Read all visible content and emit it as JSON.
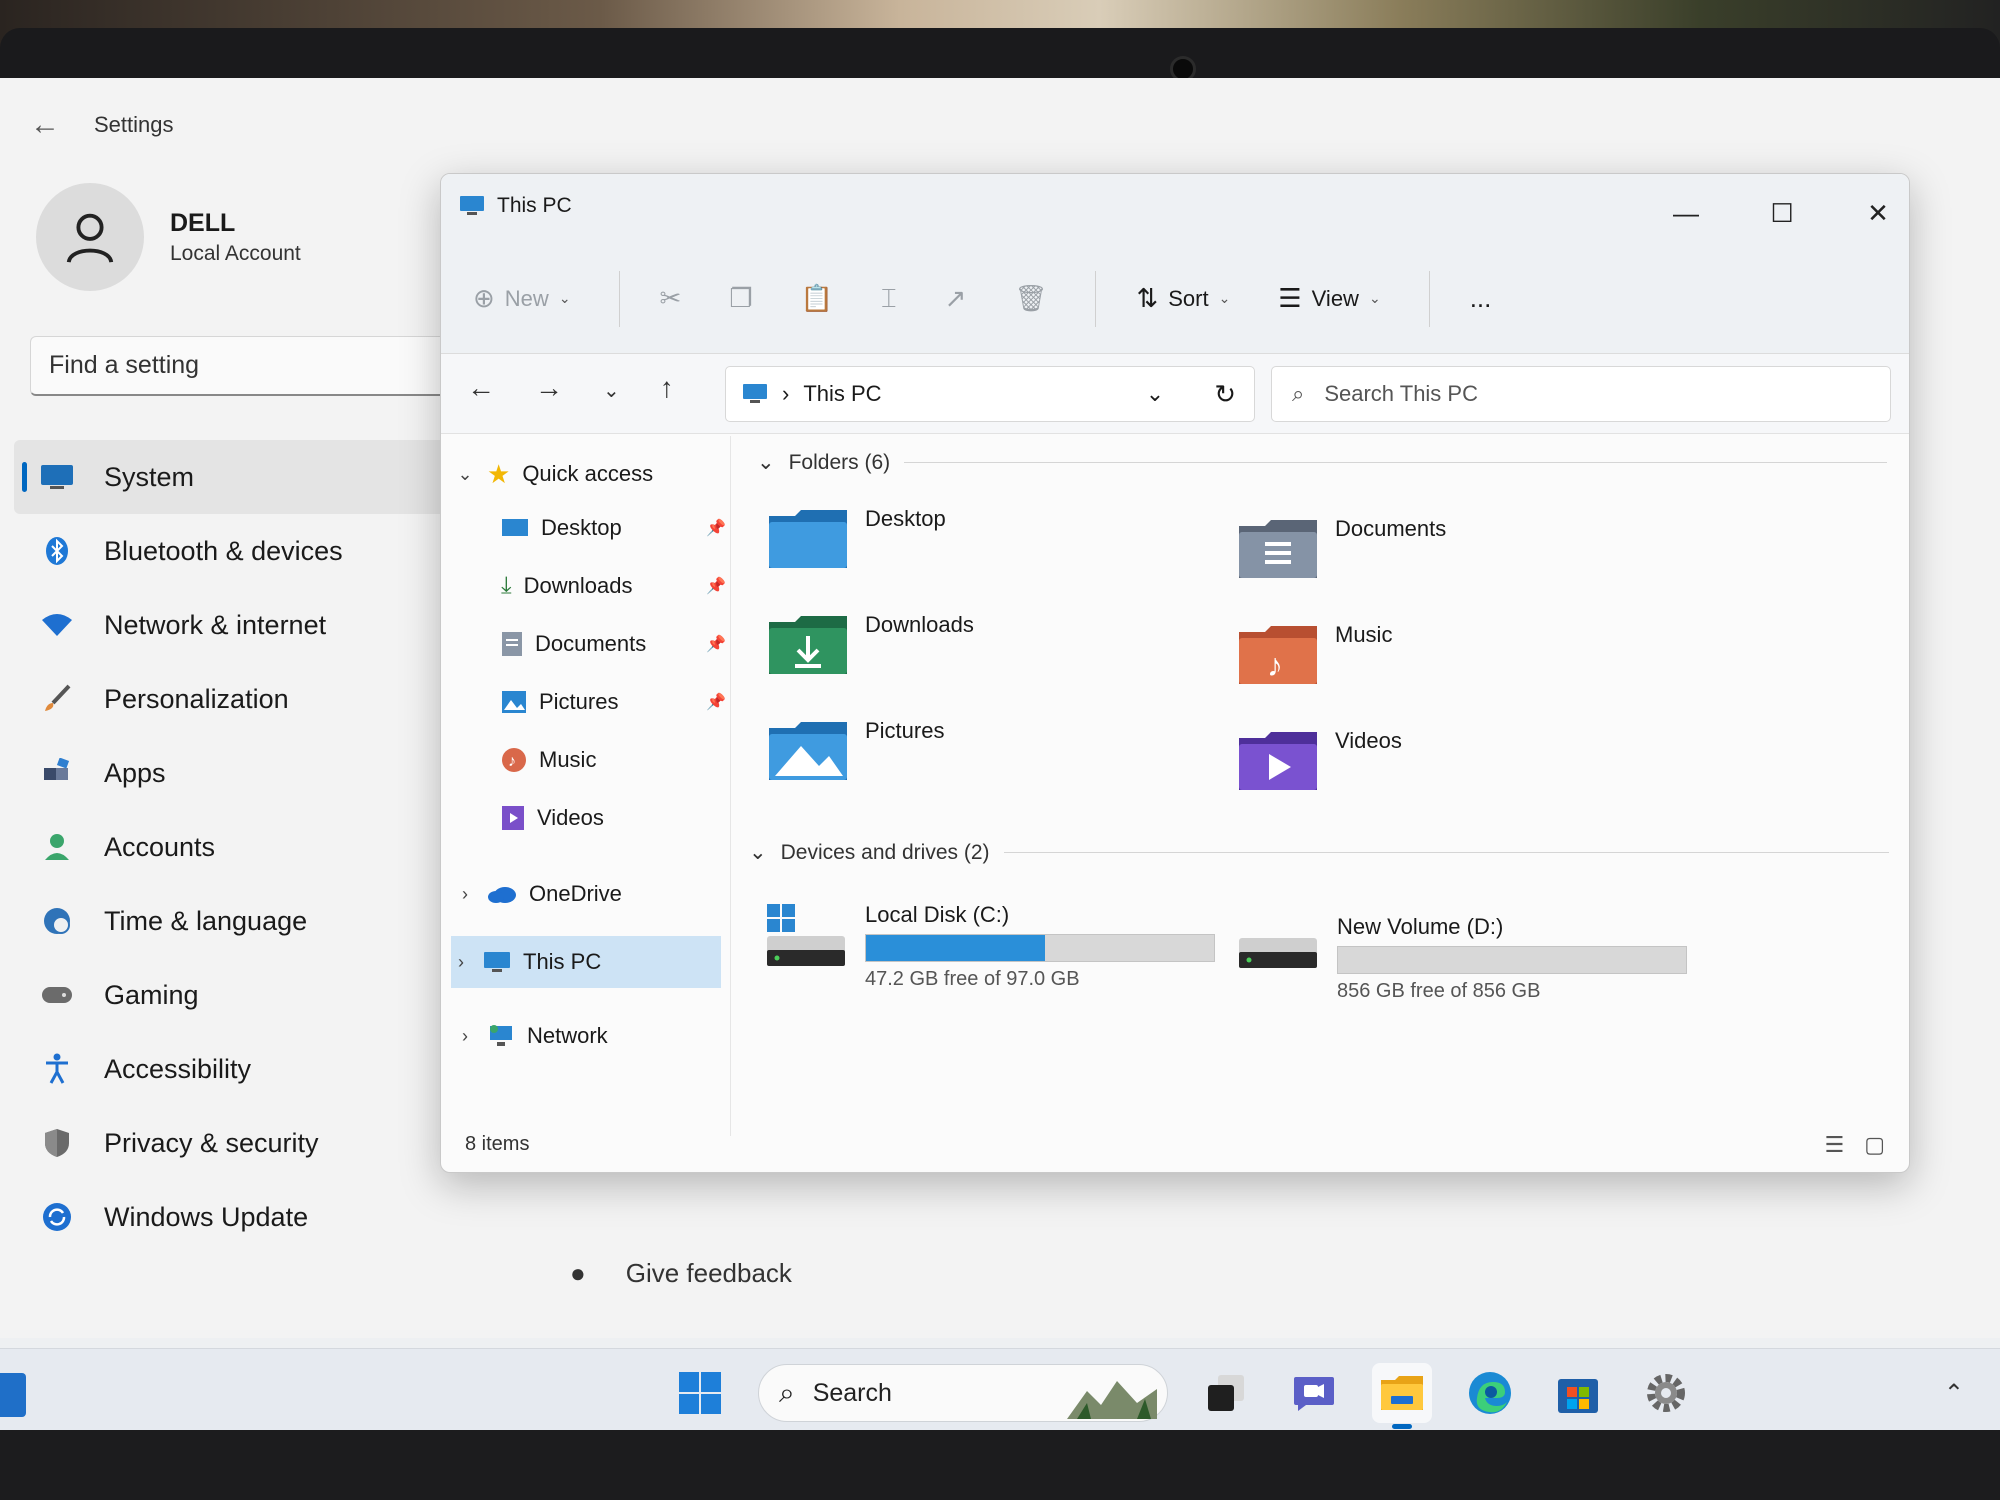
{
  "settings": {
    "title": "Settings",
    "profile": {
      "name": "DELL",
      "account_type": "Local Account"
    },
    "search_placeholder": "Find a setting",
    "nav": [
      {
        "label": "System",
        "icon": "monitor-icon",
        "active": true
      },
      {
        "label": "Bluetooth & devices",
        "icon": "bluetooth-icon"
      },
      {
        "label": "Network & internet",
        "icon": "wifi-icon"
      },
      {
        "label": "Personalization",
        "icon": "brush-icon"
      },
      {
        "label": "Apps",
        "icon": "apps-icon"
      },
      {
        "label": "Accounts",
        "icon": "person-icon"
      },
      {
        "label": "Time & language",
        "icon": "clock-globe-icon"
      },
      {
        "label": "Gaming",
        "icon": "gamepad-icon"
      },
      {
        "label": "Accessibility",
        "icon": "accessibility-icon"
      },
      {
        "label": "Privacy & security",
        "icon": "shield-icon"
      },
      {
        "label": "Windows Update",
        "icon": "update-icon"
      }
    ],
    "feedback_label": "Give feedback"
  },
  "explorer": {
    "title": "This PC",
    "toolbar": {
      "new_label": "New",
      "sort_label": "Sort",
      "view_label": "View",
      "more_label": "..."
    },
    "address": {
      "path": "This PC"
    },
    "search_placeholder": "Search This PC",
    "tree": {
      "quick_access": "Quick access",
      "items": [
        {
          "label": "Desktop",
          "pinned": true
        },
        {
          "label": "Downloads",
          "pinned": true
        },
        {
          "label": "Documents",
          "pinned": true
        },
        {
          "label": "Pictures",
          "pinned": true
        },
        {
          "label": "Music",
          "pinned": false
        },
        {
          "label": "Videos",
          "pinned": false
        }
      ],
      "onedrive": "OneDrive",
      "this_pc": "This PC",
      "network": "Network"
    },
    "folders_header": "Folders (6)",
    "folders": [
      {
        "label": "Desktop"
      },
      {
        "label": "Documents"
      },
      {
        "label": "Downloads"
      },
      {
        "label": "Music"
      },
      {
        "label": "Pictures"
      },
      {
        "label": "Videos"
      }
    ],
    "drives_header": "Devices and drives (2)",
    "drives": [
      {
        "label": "Local Disk (C:)",
        "free_text": "47.2 GB free of 97.0 GB",
        "used_fraction": 0.513
      },
      {
        "label": "New Volume (D:)",
        "free_text": "856 GB free of 856 GB",
        "used_fraction": 0.0
      }
    ],
    "status": "8 items"
  },
  "taskbar": {
    "search_label": "Search"
  },
  "colors": {
    "accent": "#0067c0",
    "drive_fill": "#2a8fd9"
  }
}
